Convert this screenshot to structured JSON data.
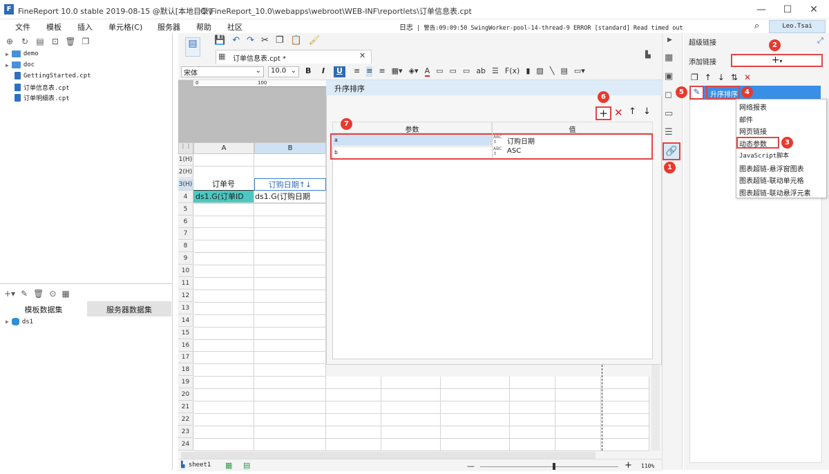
{
  "app": {
    "title": "FineReport 10.0 stable 2019-08-15 @默认[本地目录]",
    "path": "C:\\FineReport_10.0\\webapps\\webroot\\WEB-INF\\reportlets\\订单信息表.cpt"
  },
  "menu": [
    "文件",
    "模板",
    "插入",
    "单元格(C)",
    "服务器",
    "帮助",
    "社区"
  ],
  "log": {
    "label": "日志",
    "warning": "警告:09:09:50 SwingWorker-pool-14-thread-9 ERROR [standard] Read timed out"
  },
  "user": "Leo.Tsai",
  "file_tree": [
    {
      "name": "demo",
      "type": "folder"
    },
    {
      "name": "doc",
      "type": "folder"
    },
    {
      "name": "GettingStarted.cpt",
      "type": "file"
    },
    {
      "name": "订单信息表.cpt",
      "type": "file"
    },
    {
      "name": "订单明细表.cpt",
      "type": "file"
    }
  ],
  "dataset_tabs": [
    "模板数据集",
    "服务器数据集"
  ],
  "datasets": [
    "ds1"
  ],
  "doc_tab": "订单信息表.cpt *",
  "format": {
    "font": "宋体",
    "size": "10.0"
  },
  "columns": [
    "A",
    "B"
  ],
  "rows": [
    "1(H)",
    "2(H)",
    "3(H)",
    "4",
    "5",
    "6",
    "7",
    "8",
    "9",
    "10",
    "11",
    "12",
    "13",
    "14",
    "15",
    "16",
    "17",
    "18",
    "19",
    "20",
    "21",
    "22",
    "23",
    "24"
  ],
  "cells": {
    "a3": "订单号",
    "b3": "订购日期↑↓",
    "a4": "ds1.G(订单ID",
    "b4": "ds1.G(订购日期"
  },
  "ruler_ticks": [
    "0",
    "100"
  ],
  "dialog": {
    "title": "升序排序",
    "headers": [
      "参数",
      "值"
    ],
    "params": [
      {
        "name": "a",
        "value": "订购日期"
      },
      {
        "name": "b",
        "value": "ASC"
      }
    ]
  },
  "right_panel": {
    "title": "超级链接",
    "add_label": "添加链接",
    "selected_link": "升序排序",
    "dropdown": [
      "网络报表",
      "邮件",
      "网页链接",
      "动态参数",
      "JavaScript脚本",
      "图表超链-悬浮窗图表",
      "图表超链-联动单元格",
      "图表超链-联动悬浮元素"
    ]
  },
  "badges": [
    "1",
    "2",
    "3",
    "4",
    "5",
    "6",
    "7"
  ],
  "sheet": "sheet1",
  "zoom": "110%",
  "colors": {
    "accent": "#2e6bb5",
    "selection": "#3a8ee6",
    "highlight_red": "#e44343",
    "teal": "#4cc8c0"
  }
}
